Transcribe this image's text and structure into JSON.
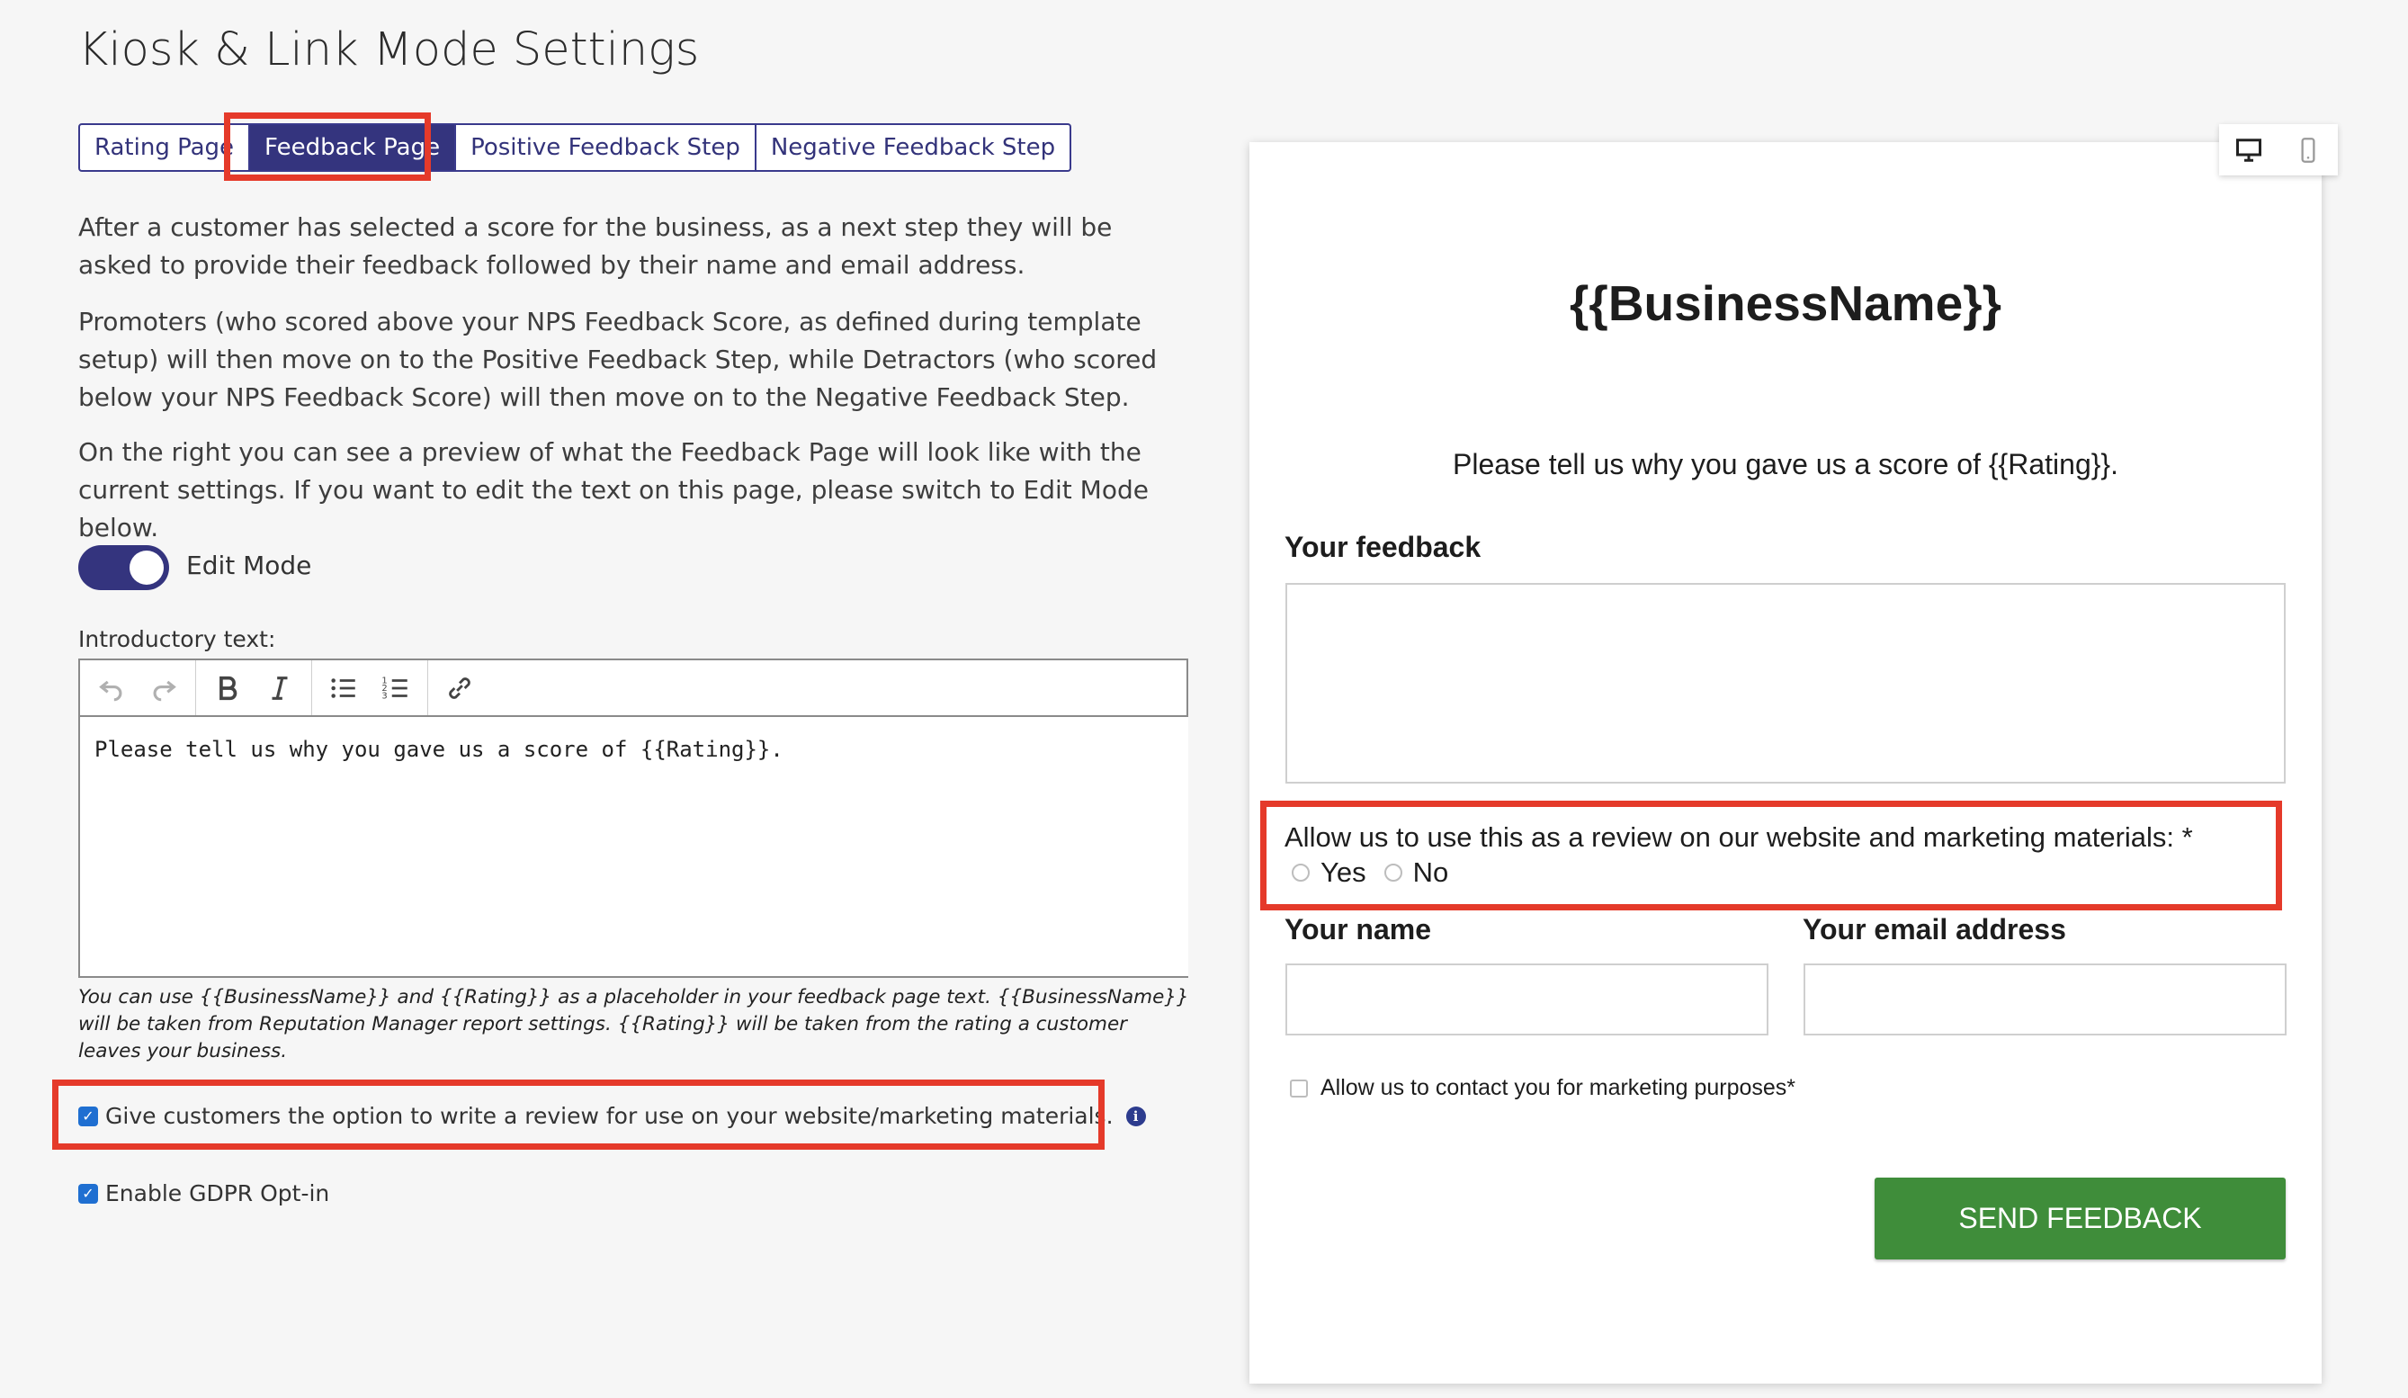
{
  "page": {
    "title": "Kiosk & Link Mode Settings"
  },
  "tabs": [
    {
      "label": "Rating Page"
    },
    {
      "label": "Feedback Page"
    },
    {
      "label": "Positive Feedback Step"
    },
    {
      "label": "Negative Feedback Step"
    }
  ],
  "active_tab": "Feedback Page",
  "description": {
    "p1": "After a customer has selected a score for the business, as a next step they will be asked to provide their feedback followed by their name and email address.",
    "p2": "Promoters (who scored above your NPS Feedback Score, as defined during template setup) will then move on to the Positive Feedback Step, while Detractors (who scored below your NPS Feedback Score) will then move on to the Negative Feedback Step.",
    "p3": "On the right you can see a preview of what the Feedback Page will look like with the current settings. If you want to edit the text on this page, please switch to Edit Mode below."
  },
  "edit_mode": {
    "label": "Edit Mode",
    "enabled": true
  },
  "editor": {
    "label": "Introductory text:",
    "toolbar": [
      "undo-icon",
      "redo-icon",
      "bold-icon",
      "italic-icon",
      "bullet-list-icon",
      "numbered-list-icon",
      "link-icon"
    ],
    "content": "Please tell us why you gave us a score of {{Rating}}.",
    "hint": "You can use {{BusinessName}} and {{Rating}} as a placeholder in your feedback page text. {{BusinessName}} will be taken from Reputation Manager report settings. {{Rating}} will be taken from the rating a customer leaves your business."
  },
  "options": {
    "review_option": {
      "label": "Give customers the option to write a review for use on your website/marketing materials.",
      "checked": true
    },
    "gdpr": {
      "label": "Enable GDPR Opt-in",
      "checked": true
    }
  },
  "preview": {
    "business_name": "{{BusinessName}}",
    "intro": "Please tell us why you gave us a score of {{Rating}}.",
    "feedback_label": "Your feedback",
    "review_question": "Allow us to use this as a review on our website and marketing materials: *",
    "yes_label": "Yes",
    "no_label": "No",
    "name_label": "Your name",
    "email_label": "Your email address",
    "marketing_consent": "Allow us to contact you for marketing purposes*",
    "send_button": "SEND FEEDBACK"
  },
  "colors": {
    "accent": "#34347e",
    "highlight": "#e53a2a",
    "send_button": "#3f8d3a",
    "checkbox": "#1f6fd1"
  }
}
